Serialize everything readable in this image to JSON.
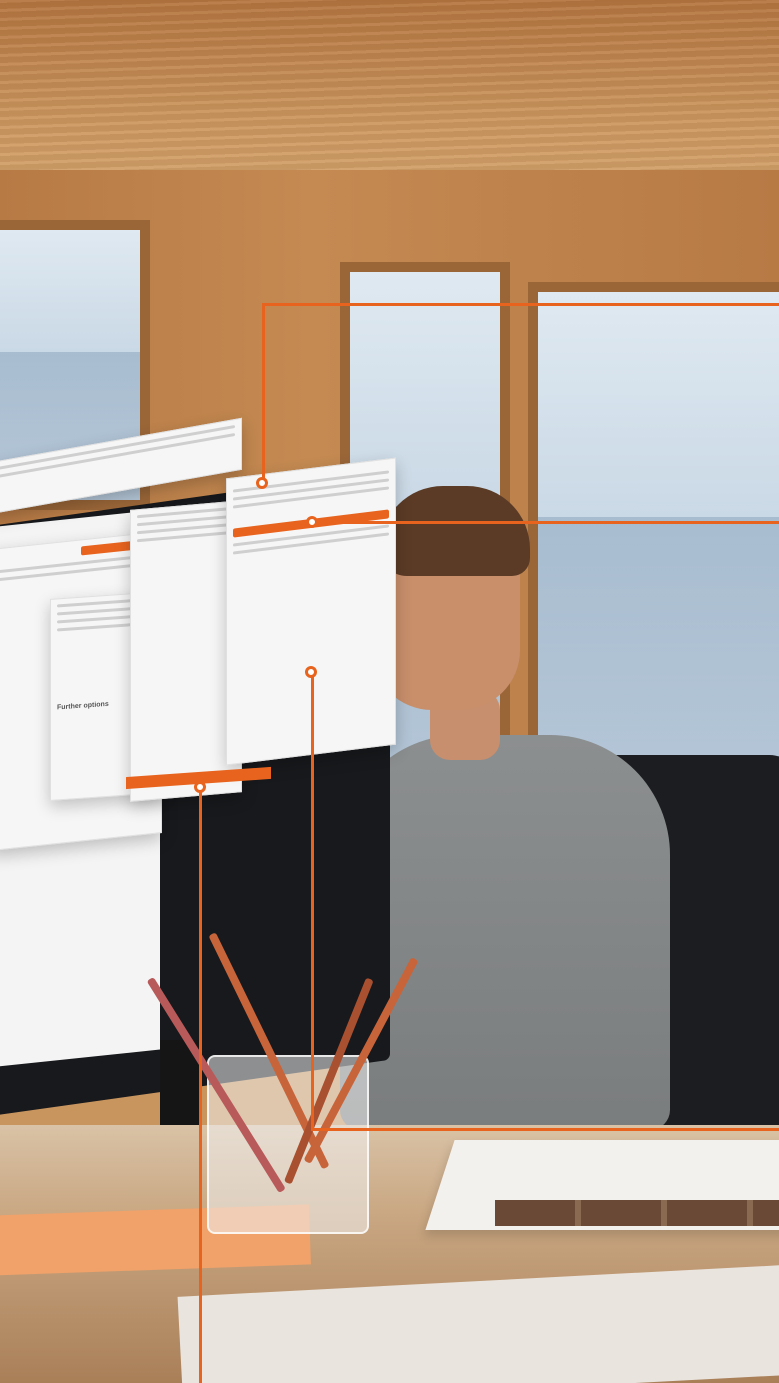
{
  "scene": {
    "callout_color": "#e8641e",
    "panel_headings": {
      "right_panel_primary": "",
      "left_panel_footer": "Further options"
    }
  }
}
